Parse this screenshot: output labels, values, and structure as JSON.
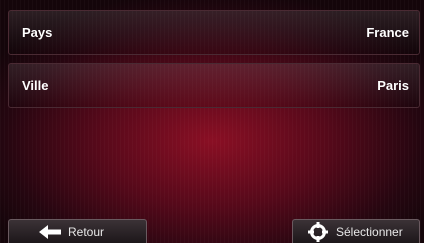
{
  "rows": [
    {
      "label": "Pays",
      "value": "France"
    },
    {
      "label": "Ville",
      "value": "Paris"
    }
  ],
  "bottom_bar": {
    "back_label": "Retour",
    "back_icon": "arrow-left-icon",
    "select_label": "Sélectionner",
    "select_icon": "crosshair-icon"
  },
  "colors": {
    "background_center": "#8a0f24",
    "background_edge": "#14050a",
    "text": "#ffffff"
  }
}
